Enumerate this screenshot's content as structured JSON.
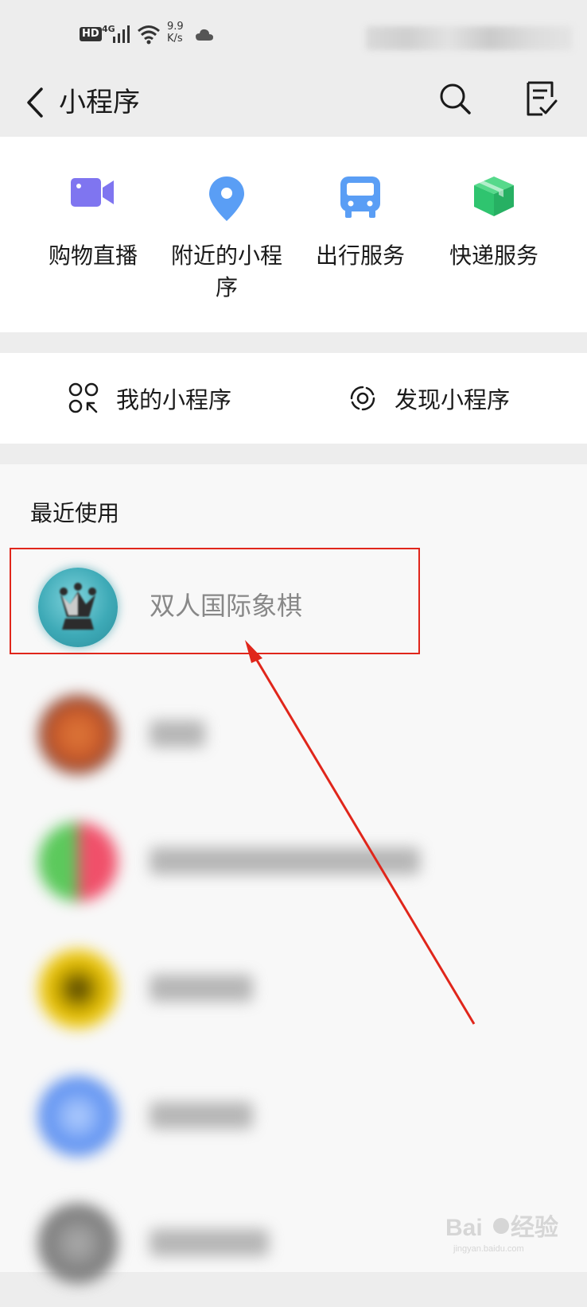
{
  "status_bar": {
    "hd": "HD",
    "network": "4G",
    "speed_value": "9.9",
    "speed_unit": "K/s"
  },
  "nav": {
    "title": "小程序",
    "back_icon": "chevron-left-icon",
    "search_icon": "search-icon",
    "note_icon": "checklist-icon"
  },
  "categories": [
    {
      "label": "购物直播",
      "icon": "video-camera-icon",
      "color": "#7f75f0"
    },
    {
      "label": "附近的小程序",
      "icon": "location-pin-icon",
      "color": "#5a9ef5"
    },
    {
      "label": "出行服务",
      "icon": "bus-icon",
      "color": "#5a9ef5"
    },
    {
      "label": "快递服务",
      "icon": "package-icon",
      "color": "#2fc46f"
    }
  ],
  "mine": {
    "my_label": "我的小程序",
    "discover_label": "发现小程序"
  },
  "recent": {
    "title": "最近使用",
    "items": [
      {
        "name": "双人国际象棋",
        "icon": "chess-king-icon"
      }
    ]
  },
  "colors": {
    "highlight": "#e0261b",
    "nav_bg": "#ededed",
    "card_bg": "#ffffff"
  }
}
